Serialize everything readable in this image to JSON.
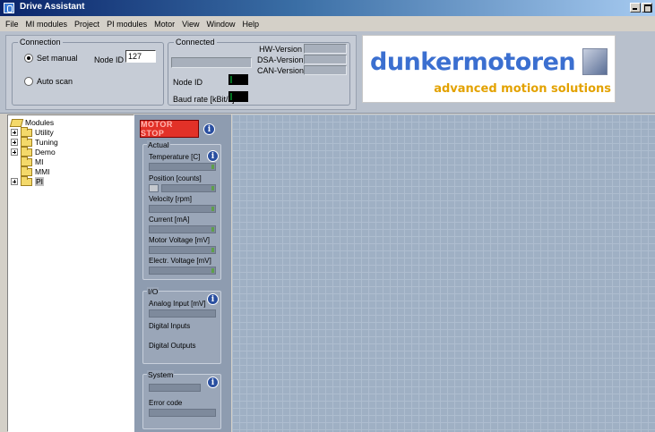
{
  "window": {
    "title": "Drive Assistant"
  },
  "menu": [
    "File",
    "MI modules",
    "Project",
    "PI modules",
    "Motor",
    "View",
    "Window",
    "Help"
  ],
  "connection": {
    "legend": "Connection",
    "set_manual": "Set manual",
    "auto_scan": "Auto scan",
    "node_id_label": "Node ID",
    "node_id_value": "127",
    "selected": "Set manual"
  },
  "connected": {
    "legend": "Connected",
    "node_id_label": "Node ID",
    "baud_label": "Baud rate [kBit/s]",
    "hw_version": "HW-Version",
    "dsa_version": "DSA-Version",
    "can_version": "CAN-Version"
  },
  "logo": {
    "brand": "dunkermotoren",
    "tagline": "advanced motion solutions"
  },
  "tree": {
    "root": "Modules",
    "items": [
      {
        "label": "Utility",
        "expandable": true
      },
      {
        "label": "Tuning",
        "expandable": true
      },
      {
        "label": "Demo",
        "expandable": true
      },
      {
        "label": "MI",
        "expandable": false
      },
      {
        "label": "MMI",
        "expandable": false
      },
      {
        "label": "PI",
        "expandable": true,
        "selected": true
      }
    ]
  },
  "panel": {
    "motor_stop": "MOTOR STOP",
    "actual": {
      "title": "Actual",
      "temperature": "Temperature [C]",
      "position": "Position [counts]",
      "velocity": "Velocity [rpm]",
      "current": "Current [mA]",
      "motor_voltage": "Motor Voltage [mV]",
      "electr_voltage": "Electr. Voltage [mV]"
    },
    "io": {
      "title": "I/O",
      "analog_input": "Analog Input [mV]",
      "digital_inputs": "Digital Inputs",
      "digital_outputs": "Digital Outputs"
    },
    "system": {
      "title": "System",
      "error_code": "Error code"
    },
    "info_glyph": "i"
  },
  "colors": {
    "motor_stop": "#e23128",
    "brand": "#3b6fd0",
    "tagline": "#e3a200"
  }
}
